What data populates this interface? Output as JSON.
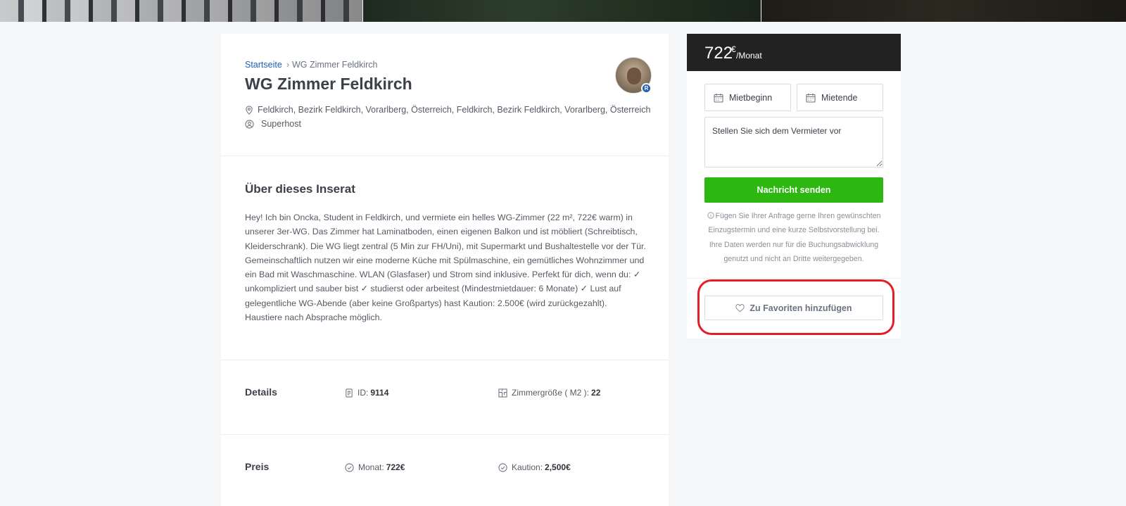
{
  "listing": {
    "breadcrumb_home": "Startseite",
    "breadcrumb_current": "WG Zimmer Feldkirch",
    "title": "WG Zimmer Feldkirch",
    "location": "Feldkirch, Bezirk Feldkirch, Vorarlberg, Österreich, Feldkirch, Bezirk Feldkirch, Vorarlberg, Österreich",
    "host_type": "Superhost",
    "avatar_badge": "R"
  },
  "about": {
    "title": "Über dieses Inserat",
    "text": "Hey! Ich bin Oncka, Student in Feldkirch, und vermiete ein helles WG-Zimmer (22 m², 722€ warm) in unserer 3er-WG. Das Zimmer hat Laminatboden, einen eigenen Balkon und ist möbliert (Schreibtisch, Kleiderschrank). Die WG liegt zentral (5 Min zur FH/Uni), mit Supermarkt und Bushaltestelle vor der Tür. Gemeinschaftlich nutzen wir eine moderne Küche mit Spülmaschine, ein gemütliches Wohnzimmer und ein Bad mit Waschmaschine. WLAN (Glasfaser) und Strom sind inklusive. Perfekt für dich, wenn du: ✓ unkompliziert und sauber bist ✓ studierst oder arbeitest (Mindestmietdauer: 6 Monate) ✓ Lust auf gelegentliche WG-Abende (aber keine Großpartys) hast Kaution: 2.500€ (wird zurückgezahlt). Haustiere nach Absprache möglich."
  },
  "details": {
    "label": "Details",
    "id_label": "ID:",
    "id_value": "9114",
    "size_label": "Zimmergröße ( M2 ):",
    "size_value": "22"
  },
  "price": {
    "label": "Preis",
    "month_label": "Monat:",
    "month_value": "722€",
    "deposit_label": "Kaution:",
    "deposit_value": "2,500€"
  },
  "sidebar": {
    "amount": "722",
    "currency": "€",
    "unit": "/Monat",
    "start_label": "Mietbeginn",
    "end_label": "Mietende",
    "message_placeholder": "Stellen Sie sich dem Vermieter vor",
    "send_label": "Nachricht senden",
    "note": "Fügen Sie Ihrer Anfrage gerne Ihren gewünschten Einzugstermin und eine kurze Selbstvorstellung bei. Ihre Daten werden nur für die Buchungsabwicklung genutzt und nicht an Dritte weitergegeben.",
    "favorite_label": "Zu Favoriten hinzufügen"
  },
  "colors": {
    "accent_green": "#2cb811",
    "link_blue": "#1f5fb4",
    "highlight_red": "#e21f26"
  },
  "icons": [
    "location-pin-icon",
    "user-circle-icon",
    "calendar-icon",
    "info-icon",
    "heart-icon",
    "document-icon",
    "floorplan-icon",
    "check-circle-icon"
  ]
}
